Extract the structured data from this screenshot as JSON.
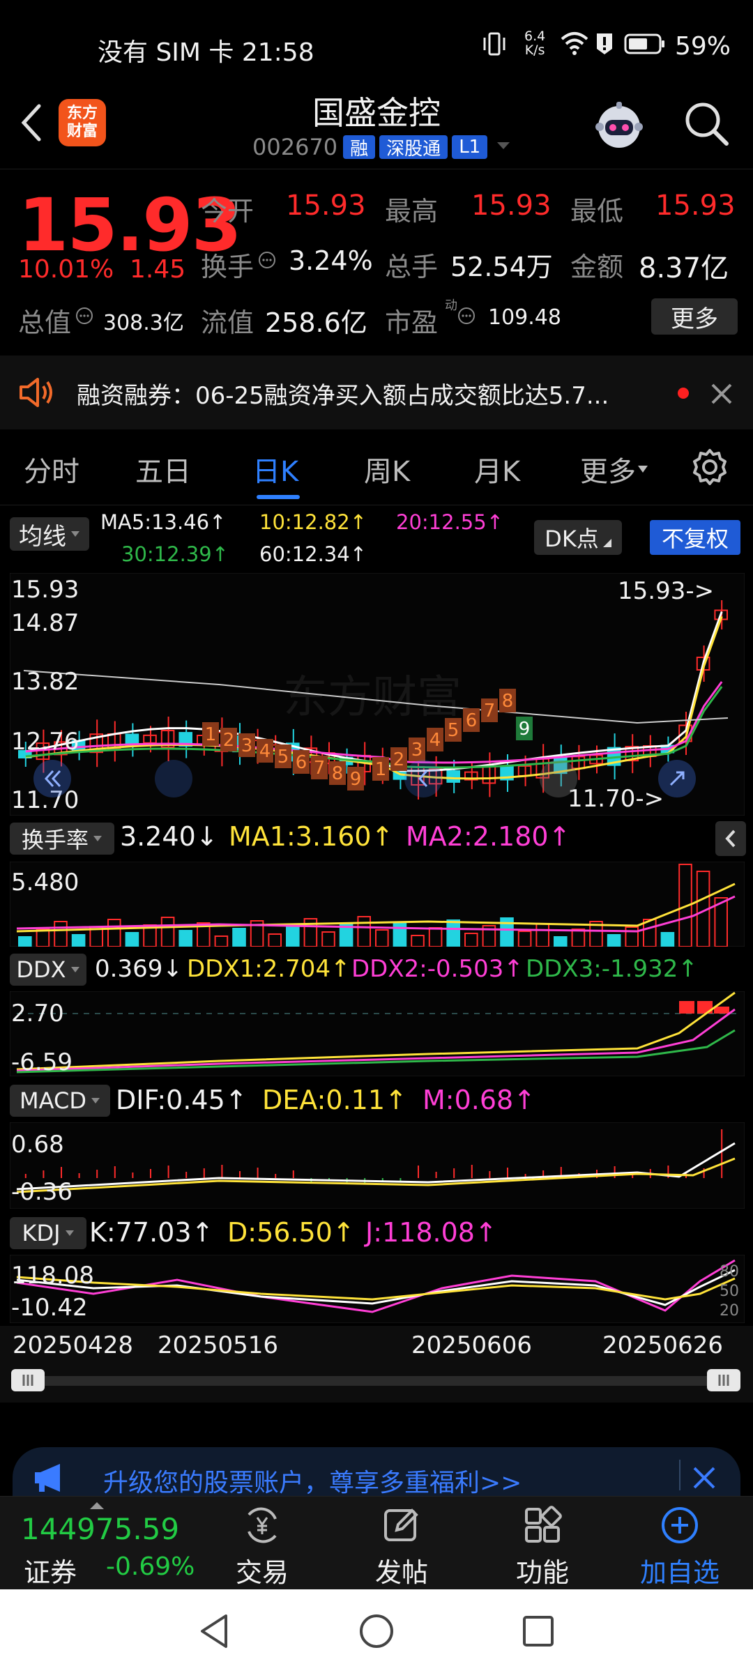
{
  "status_bar": {
    "left": "没有 SIM 卡 21:58",
    "net_speed_top": "6.4",
    "net_speed_bottom": "K/s",
    "battery": "59%"
  },
  "header": {
    "logo_text_line1": "东方",
    "logo_text_line2": "财富",
    "title": "国盛金控",
    "code": "002670",
    "tags": [
      "融",
      "深股通",
      "L1"
    ]
  },
  "quote": {
    "price": "15.93",
    "change_pct": "10.01%",
    "change_amt": "1.45",
    "labels": {
      "open": "今开",
      "high": "最高",
      "low": "最低",
      "turnover": "换手",
      "volume": "总手",
      "amount": "金额",
      "mkt_cap": "总值",
      "float_cap": "流值",
      "pe": "市盈",
      "pe_superscript": "动"
    },
    "values": {
      "open": "15.93",
      "high": "15.93",
      "low": "15.93",
      "turnover": "3.24%",
      "volume": "52.54万",
      "amount": "8.37亿",
      "mkt_cap": "308.3亿",
      "float_cap": "258.6亿",
      "pe": "109.48"
    },
    "more_button": "更多"
  },
  "notice": {
    "text": "融资融券：06-25融资净买入额占成交额比达5.7..."
  },
  "tabs": [
    "分时",
    "五日",
    "日K",
    "周K",
    "月K",
    "更多"
  ],
  "active_tab_index": 2,
  "kline": {
    "indicator_button": "均线",
    "ma5": "MA5:13.46↑",
    "ma10": "10:12.82↑",
    "ma20": "20:12.55↑",
    "ma30": "30:12.39↑",
    "ma60": "60:12.34↑",
    "dk_button": "DK点",
    "fq_button": "不复权",
    "y_labels": [
      "15.93",
      "14.87",
      "13.82",
      "12.76",
      "11.70"
    ],
    "high_marker": "15.93->",
    "low_marker": "11.70->",
    "watermark": "东方财富",
    "td_red_seq_1": [
      "1",
      "2",
      "3",
      "4",
      "5",
      "6",
      "7",
      "8",
      "9"
    ],
    "td_red_seq_2": [
      "1",
      "2",
      "3",
      "4",
      "5",
      "6",
      "7",
      "8"
    ],
    "td_green_9": "9"
  },
  "turnover_panel": {
    "name": "换手率",
    "value": "3.240↓",
    "ma1": "MA1:3.160↑",
    "ma2": "MA2:2.180↑",
    "y_label": "5.480"
  },
  "ddx_panel": {
    "name": "DDX",
    "value": "0.369↓",
    "ddx1": "DDX1:2.704↑",
    "ddx2": "DDX2:-0.503↑",
    "ddx3": "DDX3:-1.932↑",
    "y_top": "2.70",
    "y_bottom": "-6.59"
  },
  "macd_panel": {
    "name": "MACD",
    "dif": "DIF:0.45↑",
    "dea": "DEA:0.11↑",
    "m": "M:0.68↑",
    "y_top": "0.68",
    "y_bottom": "-0.36"
  },
  "kdj_panel": {
    "name": "KDJ",
    "k": "K:77.03↑",
    "d": "D:56.50↑",
    "j": "J:118.08↑",
    "y_top": "118.08",
    "y_bottom": "-10.42",
    "right_levels": [
      "80",
      "50",
      "20"
    ]
  },
  "x_axis_dates": [
    "20250428",
    "20250516",
    "20250606",
    "20250626"
  ],
  "promo": {
    "text": "升级您的股票账户，尊享多重福利>>"
  },
  "bottom_nav": {
    "index_value": "144975.59",
    "index_name": "证券",
    "index_change": "-0.69%",
    "items": [
      "交易",
      "发帖",
      "功能",
      "加自选"
    ]
  },
  "colors": {
    "up": "#ff2b2b",
    "down": "#22d3e0",
    "accent": "#2f80ff",
    "bg": "#000000"
  }
}
